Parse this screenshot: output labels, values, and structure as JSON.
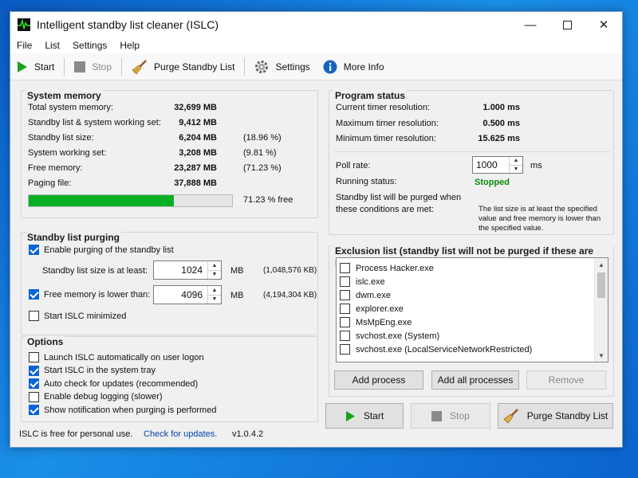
{
  "window": {
    "title": "Intelligent standby list cleaner (ISLC)"
  },
  "menu": [
    "File",
    "List",
    "Settings",
    "Help"
  ],
  "toolbar": {
    "start": "Start",
    "stop": "Stop",
    "purge": "Purge Standby List",
    "settings": "Settings",
    "more_info": "More Info"
  },
  "system_memory": {
    "title": "System memory",
    "rows": [
      {
        "label": "Total system memory:",
        "value": "32,699 MB",
        "pct": ""
      },
      {
        "label": "Standby list & system working set:",
        "value": "9,412 MB",
        "pct": ""
      },
      {
        "label": "Standby list size:",
        "value": "6,204 MB",
        "pct": "(18.96 %)"
      },
      {
        "label": "System working set:",
        "value": "3,208 MB",
        "pct": "(9.81 %)"
      },
      {
        "label": "Free memory:",
        "value": "23,287 MB",
        "pct": "(71.23 %)"
      },
      {
        "label": "Paging file:",
        "value": "37,888 MB",
        "pct": ""
      }
    ],
    "free_fraction": 0.7123,
    "free_text": "71.23 % free"
  },
  "standby_purging": {
    "title": "Standby list purging",
    "enable_label": "Enable purging of the standby list",
    "enable_checked": true,
    "size_label": "Standby list size is at least:",
    "size_value": "1024",
    "size_unit": "MB",
    "size_kb": "(1,048,576 KB)",
    "free_label": "Free memory is lower than:",
    "free_checked": true,
    "free_value": "4096",
    "free_unit": "MB",
    "free_kb": "(4,194,304 KB)",
    "minimized_label": "Start ISLC minimized",
    "minimized_checked": false
  },
  "options": {
    "title": "Options",
    "items": [
      {
        "label": "Launch ISLC automatically on user logon",
        "checked": false
      },
      {
        "label": "Start ISLC in the system tray",
        "checked": true
      },
      {
        "label": "Auto check for updates (recommended)",
        "checked": true
      },
      {
        "label": "Enable debug logging (slower)",
        "checked": false
      },
      {
        "label": "Show notification when purging is performed",
        "checked": true
      }
    ]
  },
  "footer": {
    "free_text": "ISLC is free for personal use.",
    "update_link": "Check for updates.",
    "version": "v1.0.4.2"
  },
  "program_status": {
    "title": "Program status",
    "rows": [
      {
        "label": "Current timer resolution:",
        "value": "1.000 ms"
      },
      {
        "label": "Maximum timer resolution:",
        "value": "0.500 ms"
      },
      {
        "label": "Minimum timer resolution:",
        "value": "15.625 ms"
      }
    ],
    "poll_label": "Poll rate:",
    "poll_value": "1000",
    "poll_unit": "ms",
    "running_label": "Running status:",
    "running_value": "Stopped",
    "condition_label": "Standby list will be purged when these conditions are met:",
    "condition_text": "The list size is at least the specified value and free memory is lower than the specified value."
  },
  "exclusion": {
    "title": "Exclusion list (standby list will not be purged if these are running)",
    "items": [
      "Process Hacker.exe",
      "islc.exe",
      "dwm.exe",
      "explorer.exe",
      "MsMpEng.exe",
      "svchost.exe (System)",
      "svchost.exe (LocalServiceNetworkRestricted)"
    ],
    "add_process": "Add process",
    "add_all": "Add all processes",
    "remove": "Remove"
  },
  "bottom_buttons": {
    "start": "Start",
    "stop": "Stop",
    "purge": "Purge Standby List"
  },
  "colors": {
    "accent": "#0a64d4",
    "progress": "#06b025",
    "link": "#0645ad",
    "status_stopped": "#0b8a0b"
  }
}
